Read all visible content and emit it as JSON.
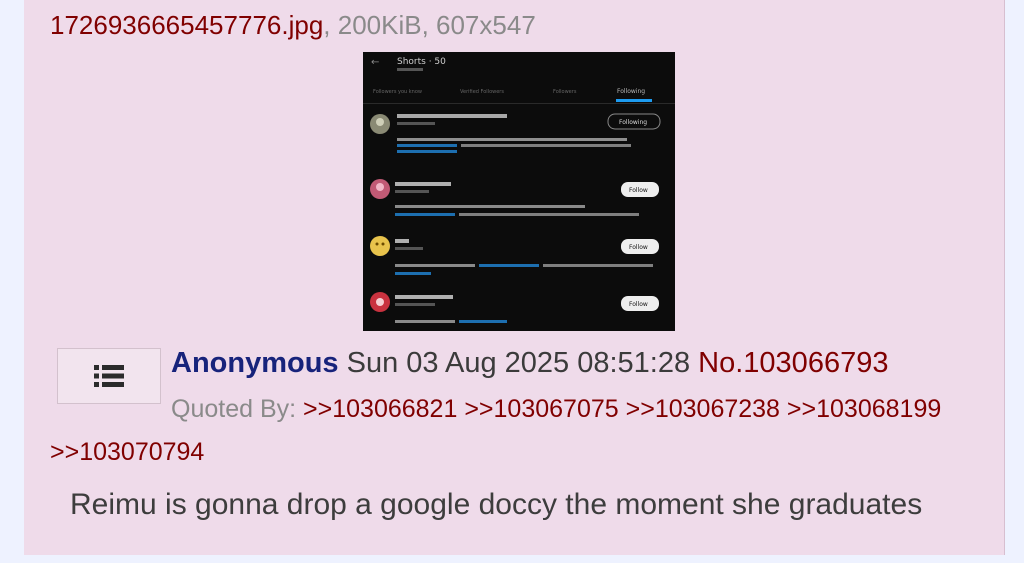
{
  "file": {
    "name": "1726936665457776.jpg",
    "meta": ", 200KiB, 607x547"
  },
  "thumbnail": {
    "header_title": "Shorts · 50",
    "tabs": [
      "Followers you know",
      "Verified Followers",
      "Followers",
      "Following"
    ],
    "rows": [
      {
        "button": "Following",
        "avatar_color": "#8a8a74"
      },
      {
        "button": "Follow",
        "avatar_color": "#c15a75"
      },
      {
        "button": "Follow",
        "avatar_color": "#e8c34c"
      },
      {
        "button": "Follow",
        "avatar_color": "#c9323f"
      }
    ]
  },
  "menu_icon": "list-menu-icon",
  "post": {
    "name": "Anonymous",
    "datetime": "Sun 03 Aug 2025 08:51:28",
    "number": "No.103066793",
    "quoted_by_label": "Quoted By:",
    "quotes": [
      ">>103066821",
      ">>103067075",
      ">>103067238",
      ">>103068199",
      ">>103070794"
    ],
    "comment": "Reimu is gonna drop a google doccy the moment she graduates"
  },
  "colors": {
    "post_background": "#efdbea",
    "name": "#17237b",
    "link": "#800000",
    "muted": "#8a8a8a"
  }
}
